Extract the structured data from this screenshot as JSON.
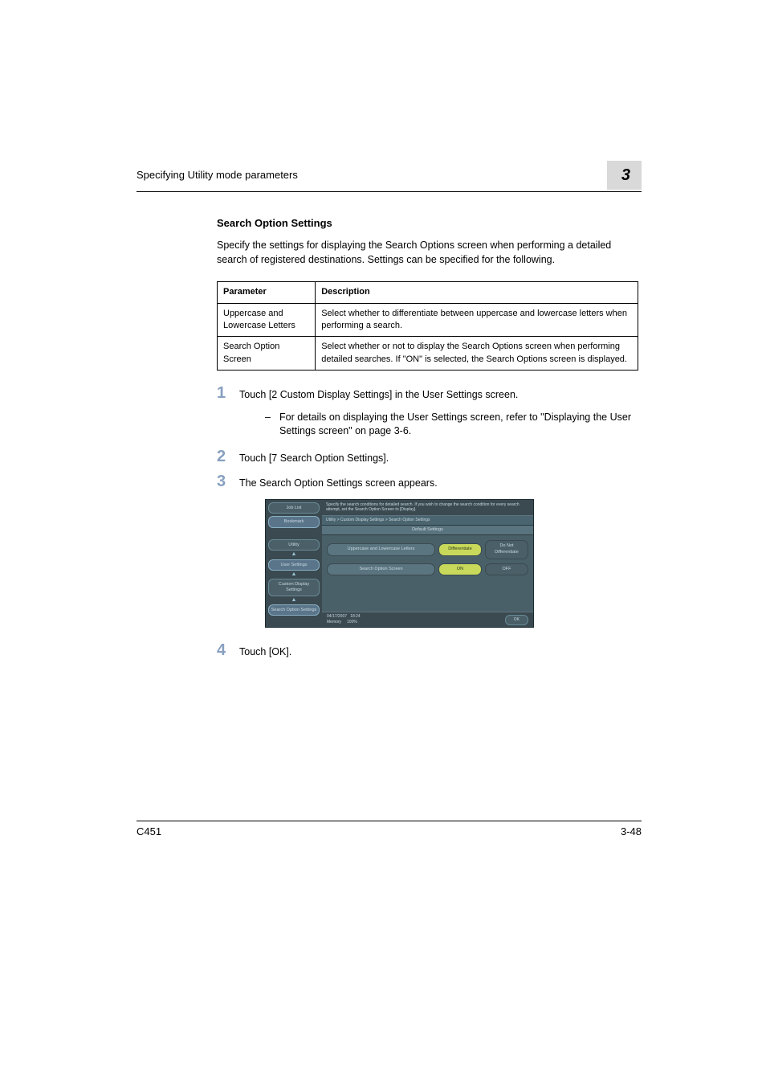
{
  "header": {
    "title": "Specifying Utility mode parameters",
    "chapter": "3"
  },
  "section": {
    "heading": "Search Option Settings",
    "intro": "Specify the settings for displaying the Search Options screen when performing a detailed search of registered destinations. Settings can be specified for the following."
  },
  "table": {
    "headers": {
      "param": "Parameter",
      "desc": "Description"
    },
    "rows": [
      {
        "param": "Uppercase and Lowercase Letters",
        "desc": "Select whether to differentiate between uppercase and lowercase letters when performing a search."
      },
      {
        "param": "Search Option Screen",
        "desc": "Select whether or not to display the Search Options screen when performing detailed searches. If \"ON\" is selected, the Search Options screen is displayed."
      }
    ]
  },
  "steps": [
    {
      "num": "1",
      "text": "Touch [2 Custom Display Settings] in the User Settings screen.",
      "sub": "For details on displaying the User Settings screen, refer to \"Displaying the User Settings screen\" on page 3-6."
    },
    {
      "num": "2",
      "text": "Touch [7 Search Option Settings]."
    },
    {
      "num": "3",
      "text": "The Search Option Settings screen appears."
    },
    {
      "num": "4",
      "text": "Touch [OK]."
    }
  ],
  "mfp": {
    "left": {
      "job_list": "Job List",
      "bookmark": "Bookmark",
      "utility": "Utility",
      "user_settings": "User Settings",
      "custom_display": "Custom Display Settings",
      "search_option": "Search Option Settings"
    },
    "instructions": "Specify the search conditions for detailed search. If you wish to change the search condition for every search attempt, set the Search Option Screen to [Display].",
    "breadcrumb": "Utility > Custom Display Settings > Search Option Settings",
    "subbar": "Default Settings",
    "row1": {
      "label": "Uppercase and Lowercase Letters",
      "opt1": "Differentiate",
      "opt2": "Do Not Differentiate"
    },
    "row2": {
      "label": "Search Option Screen",
      "opt1": "ON",
      "opt2": "OFF"
    },
    "footer": {
      "date": "04/17/2007",
      "time": "18:24",
      "memory": "Memory",
      "mempct": "100%",
      "ok": "OK"
    }
  },
  "footer": {
    "left": "C451",
    "right": "3-48"
  }
}
